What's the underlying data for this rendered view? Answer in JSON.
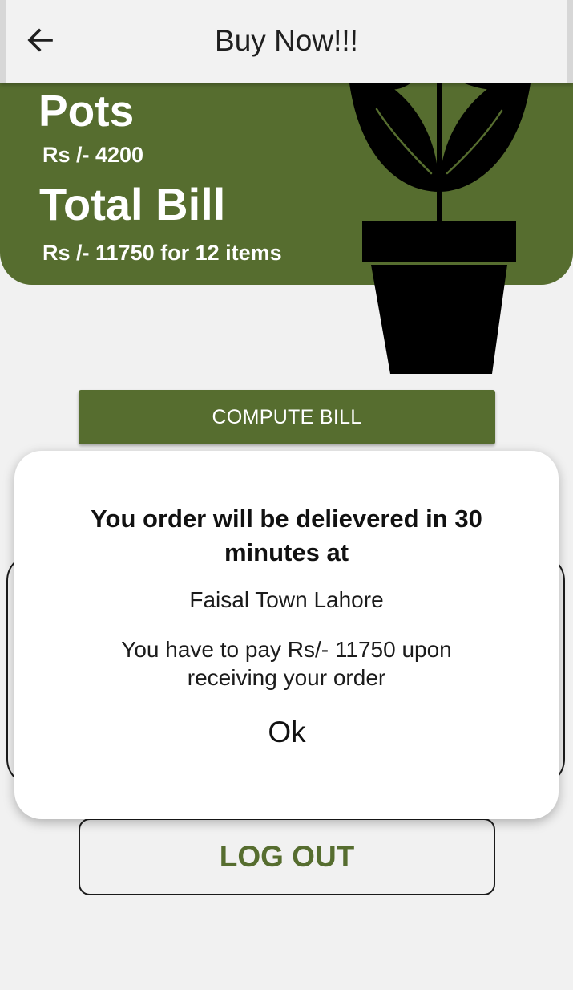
{
  "appbar": {
    "title": "Buy Now!!!",
    "back_icon": "arrow-left-icon"
  },
  "banner": {
    "item_name": "Pots",
    "item_price": "Rs /- 4200",
    "total_label": "Total Bill",
    "total_value": "Rs /- 11750 for 12 items",
    "background_color": "#566d2f",
    "illustration": "potted-plant-icon"
  },
  "actions": {
    "compute_label": "COMPUTE BILL",
    "logout_label": "LOG OUT"
  },
  "dialog": {
    "title": "You order will be delievered in 30 minutes at",
    "address": "Faisal Town Lahore",
    "message": "You have to pay Rs/- 11750 upon receiving your order",
    "ok_label": "Ok"
  },
  "colors": {
    "accent": "#566d2f",
    "background": "#f1f1f1"
  }
}
